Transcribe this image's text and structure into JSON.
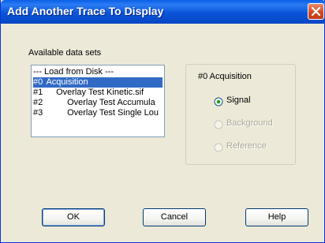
{
  "window": {
    "title": "Add Another Trace To Display"
  },
  "datasets": {
    "label": "Available data sets",
    "items": [
      {
        "num": "",
        "name": "--- Load from Disk ---",
        "selected": false
      },
      {
        "num": "#0",
        "name": "Acquisition",
        "selected": true
      },
      {
        "num": "#1",
        "name": "Overlay Test Kinetic.sif",
        "selected": false
      },
      {
        "num": "#2",
        "name": "Overlay Test Accumula",
        "selected": false
      },
      {
        "num": "#3",
        "name": "Overlay Test Single Lou",
        "selected": false
      }
    ]
  },
  "trace_group": {
    "title": "#0  Acquisition",
    "options": [
      {
        "label": "Signal",
        "checked": true,
        "enabled": true
      },
      {
        "label": "Background",
        "checked": false,
        "enabled": false
      },
      {
        "label": "Reference",
        "checked": false,
        "enabled": false
      }
    ]
  },
  "buttons": {
    "ok": "OK",
    "cancel": "Cancel",
    "help": "Help"
  },
  "colors": {
    "titlebar": "#0a54d8",
    "selection": "#316ac5",
    "dialog_bg": "#ece9d8",
    "close": "#d3451e"
  },
  "icons": {
    "close": "close-icon"
  }
}
